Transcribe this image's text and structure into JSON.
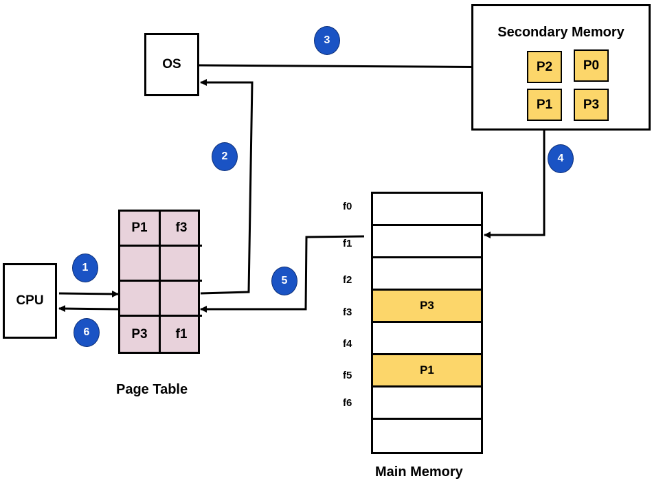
{
  "nodes": {
    "os": "OS",
    "cpu": "CPU",
    "secondary_memory": {
      "title": "Secondary Memory",
      "pages": [
        "P2",
        "P0",
        "P1",
        "P3"
      ]
    }
  },
  "page_table": {
    "title": "Page Table",
    "rows": [
      [
        "P1",
        "f3"
      ],
      [
        "",
        ""
      ],
      [
        "",
        ""
      ],
      [
        "P3",
        "f1"
      ]
    ]
  },
  "main_memory": {
    "title": "Main Memory",
    "frame_labels": [
      "f0",
      "f1",
      "f2",
      "f3",
      "f4",
      "f5",
      "f6"
    ],
    "frames": [
      "",
      "",
      "",
      "P3",
      "",
      "P1",
      "",
      ""
    ],
    "highlighted": [
      3,
      5
    ]
  },
  "steps": [
    "1",
    "2",
    "3",
    "4",
    "5",
    "6"
  ],
  "colors": {
    "badge": "#1a53c4",
    "page_yellow": "#fcd66a",
    "page_table_pink": "#e8d2db"
  }
}
